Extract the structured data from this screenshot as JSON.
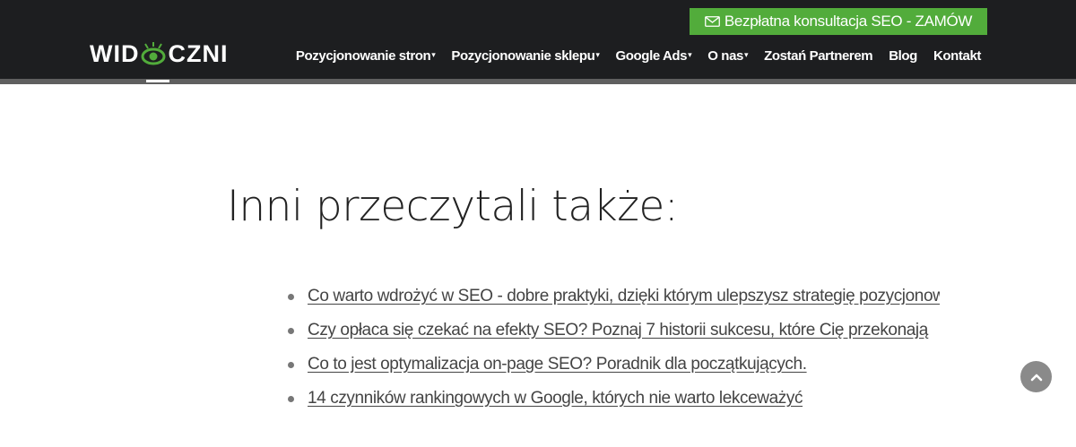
{
  "header": {
    "cta_label": "Bezpłatna konsultacja SEO - ZAMÓW",
    "logo_text_left": "WID",
    "logo_text_right": "CZNI",
    "nav": [
      {
        "label": "Pozycjonowanie stron",
        "has_dropdown": true
      },
      {
        "label": "Pozycjonowanie sklepu",
        "has_dropdown": true
      },
      {
        "label": "Google Ads",
        "has_dropdown": true
      },
      {
        "label": "O nas",
        "has_dropdown": true
      },
      {
        "label": "Zostań Partnerem",
        "has_dropdown": false
      },
      {
        "label": "Blog",
        "has_dropdown": false
      },
      {
        "label": "Kontakt",
        "has_dropdown": false
      }
    ],
    "caret": "▾"
  },
  "main": {
    "heading": "Inni przeczytali także:",
    "articles": [
      "Co warto wdrożyć w SEO - dobre praktyki, dzięki którym ulepszysz strategię pozycjonowania",
      "Czy opłaca się czekać na efekty SEO? Poznaj 7 historii sukcesu, które Cię przekonają",
      "Co to jest optymalizacja on-page SEO? Poradnik dla początkujących.",
      "14 czynników rankingowych w Google, których nie warto lekceważyć"
    ]
  },
  "icons": {
    "cta": "envelope-icon",
    "logo_eye": "eye-icon",
    "scroll_top": "chevron-up-icon"
  },
  "colors": {
    "header_bg": "#1d1e20",
    "accent_green": "#52ac3b",
    "scroll_button": "#8a8a8a"
  }
}
